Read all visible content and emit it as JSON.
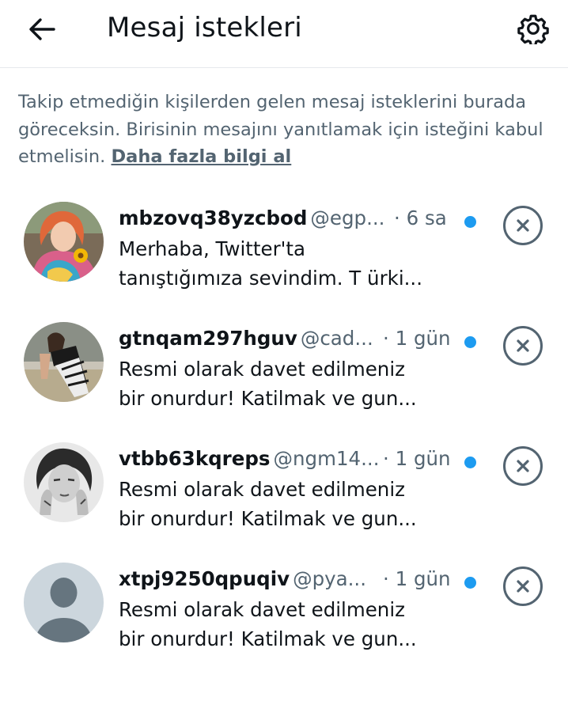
{
  "header": {
    "title": "Mesaj istekleri",
    "back_icon": "arrow-left-icon",
    "settings_icon": "gear-icon"
  },
  "info": {
    "text": "Takip etmediğin kişilerden gelen mesaj isteklerini burada göreceksin. Birisinin mesajını yanıtlamak için isteğini kabul etmelisin.",
    "link": "Daha fazla bilgi al"
  },
  "colors": {
    "accent": "#1d9bf0",
    "secondary_text": "#536471",
    "primary_text": "#0f1419"
  },
  "requests": [
    {
      "username": "mbzovq38yzcbod",
      "handle": "@egp...",
      "time": "· 6 sa",
      "line1": "Merhaba, Twitter'ta",
      "line2": "tanıştığımıza sevindim. T ürki...",
      "unread": true
    },
    {
      "username": "gtnqam297hguv",
      "handle": "@cad...",
      "time": "· 1 gün",
      "line1": "Resmi olarak davet edilmeniz",
      "line2": "bir onurdur! Katilmak ve gun...",
      "unread": true
    },
    {
      "username": "vtbb63kqreps",
      "handle": "@ngm14...",
      "time": "· 1 gün",
      "line1": "Resmi olarak davet edilmeniz",
      "line2": "bir onurdur! Katilmak ve gun...",
      "unread": true
    },
    {
      "username": "xtpj9250qpuqiv",
      "handle": "@pya...",
      "time": "· 1 gün",
      "line1": "Resmi olarak davet edilmeniz",
      "line2": "bir onurdur! Katilmak ve gun...",
      "unread": true
    }
  ]
}
